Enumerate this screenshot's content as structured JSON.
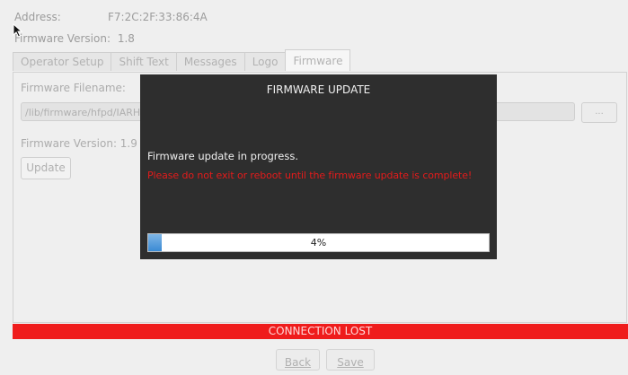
{
  "header": {
    "address_label": "Address:",
    "address_value": "F7:2C:2F:33:86:4A",
    "fw_version_label": "Firmware Version:",
    "fw_version_value": "1.8"
  },
  "tabs": [
    {
      "label": "Operator Setup"
    },
    {
      "label": "Shift Text"
    },
    {
      "label": "Messages"
    },
    {
      "label": "Logo"
    },
    {
      "label": "Firmware"
    }
  ],
  "firmware_panel": {
    "filename_label": "Firmware Filename:",
    "filename_value": "/lib/firmware/hfpd/IARH",
    "browse_label": "...",
    "version_label": "Firmware Version: 1.9",
    "update_label": "Update"
  },
  "dialog": {
    "title": "FIRMWARE UPDATE",
    "message": "Firmware update in progress.",
    "warning": "Please do not exit or reboot until the firmware update is complete!",
    "progress": 4,
    "progress_text": "4%"
  },
  "status": {
    "connection_lost": "CONNECTION LOST"
  },
  "footer": {
    "back_label": "Back",
    "save_label": "Save"
  },
  "colors": {
    "status_red": "#ef1c1c",
    "warning_red": "#e41b1b",
    "dialog_bg": "#2e2e2e",
    "progress_blue": "#3a8ad4"
  }
}
